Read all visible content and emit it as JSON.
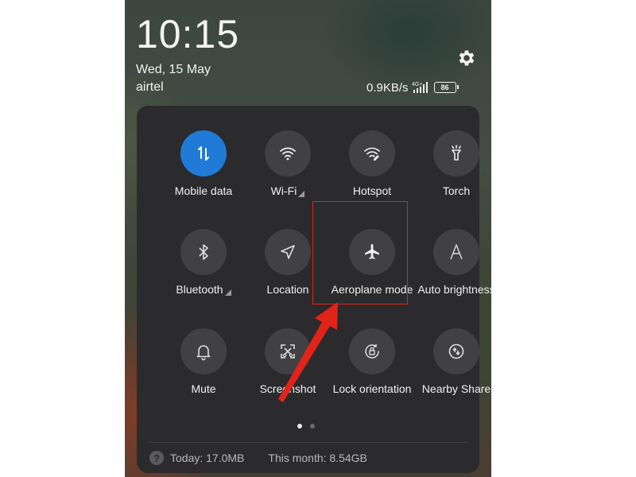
{
  "lockscreen": {
    "time": "10:15",
    "date": "Wed, 15 May",
    "carrier": "airtel",
    "network_speed": "0.9KB/s",
    "network_badge": "4G+",
    "battery_level": "86"
  },
  "quick_settings": {
    "tiles": [
      {
        "label": "Mobile data",
        "icon": "mobile-data-icon",
        "active": true
      },
      {
        "label": "Wi-Fi",
        "icon": "wifi-icon",
        "active": false
      },
      {
        "label": "Hotspot",
        "icon": "hotspot-icon",
        "active": false
      },
      {
        "label": "Torch",
        "icon": "torch-icon",
        "active": false
      },
      {
        "label": "Bluetooth",
        "icon": "bluetooth-icon",
        "active": false
      },
      {
        "label": "Location",
        "icon": "location-icon",
        "active": false
      },
      {
        "label": "Aeroplane mode",
        "icon": "airplane-icon",
        "active": false
      },
      {
        "label": "Auto brightness",
        "icon": "auto-brightness-icon",
        "active": false
      },
      {
        "label": "Mute",
        "icon": "bell-icon",
        "active": false
      },
      {
        "label": "Screenshot",
        "icon": "screenshot-icon",
        "active": false
      },
      {
        "label": "Lock orientation",
        "icon": "lock-rotation-icon",
        "active": false
      },
      {
        "label": "Nearby Share",
        "icon": "nearby-share-icon",
        "active": false
      }
    ],
    "page_indicator": {
      "pages": 2,
      "current": 1
    }
  },
  "data_usage": {
    "today": "Today: 17.0MB",
    "month": "This month: 8.54GB"
  },
  "colors": {
    "active_tile": "#1f7bd6",
    "tile": "#414144",
    "panel": "#2b2b2d",
    "annotation": "#e2231a"
  }
}
